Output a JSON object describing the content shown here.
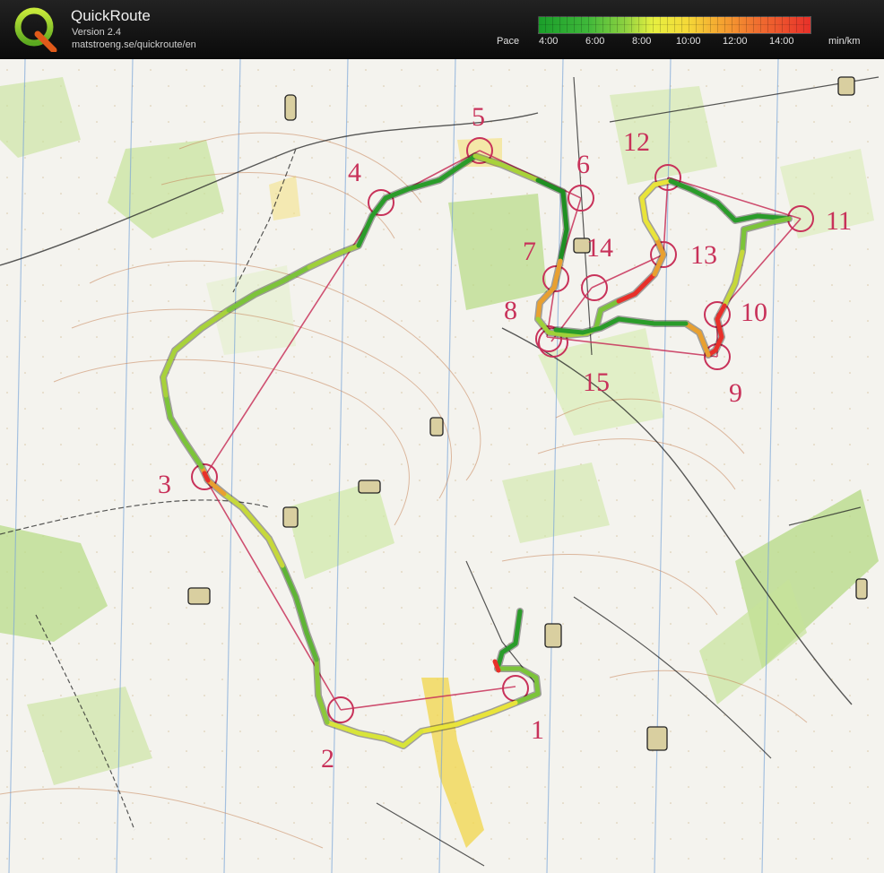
{
  "header": {
    "title": "QuickRoute",
    "version": "Version 2.4",
    "url": "matstroeng.se/quickroute/en"
  },
  "legend": {
    "label": "Pace",
    "ticks": [
      "4:00",
      "6:00",
      "8:00",
      "10:00",
      "12:00",
      "14:00"
    ],
    "unit": "min/km",
    "colors": [
      "#1a9e2a",
      "#3fb83a",
      "#8fd240",
      "#e7f040",
      "#f5a030",
      "#e8302a"
    ]
  },
  "map": {
    "control_labels": [
      "1",
      "2",
      "3",
      "4",
      "5",
      "6",
      "7",
      "8",
      "9",
      "10",
      "11",
      "12",
      "13",
      "14",
      "15"
    ],
    "control_color": "#c8325a",
    "route_colors": {
      "fast": "#1a9e2a",
      "medium": "#e7f040",
      "slow": "#e8302a"
    }
  }
}
